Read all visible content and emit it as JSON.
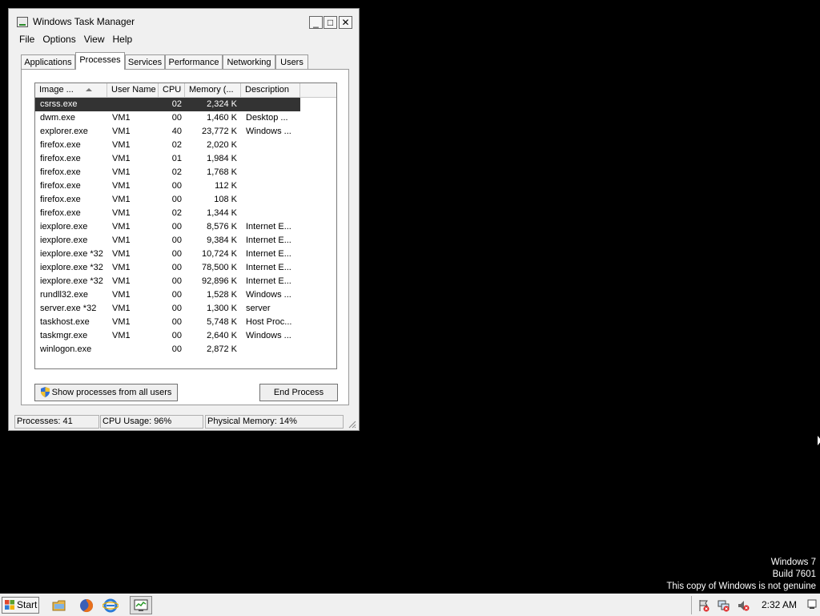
{
  "window": {
    "title": "Windows Task Manager",
    "controls": {
      "minimize": "_",
      "maximize": "□",
      "close": "✕"
    }
  },
  "menu": [
    "File",
    "Options",
    "View",
    "Help"
  ],
  "tabs": [
    "Applications",
    "Processes",
    "Services",
    "Performance",
    "Networking",
    "Users"
  ],
  "active_tab": "Processes",
  "columns": [
    "Image ...",
    "User Name",
    "CPU",
    "Memory (...",
    "Description"
  ],
  "processes": [
    {
      "name": "csrss.exe",
      "user": "",
      "cpu": "02",
      "mem": "2,324 K",
      "desc": ""
    },
    {
      "name": "dwm.exe",
      "user": "VM1",
      "cpu": "00",
      "mem": "1,460 K",
      "desc": "Desktop ..."
    },
    {
      "name": "explorer.exe",
      "user": "VM1",
      "cpu": "40",
      "mem": "23,772 K",
      "desc": "Windows ..."
    },
    {
      "name": "firefox.exe",
      "user": "VM1",
      "cpu": "02",
      "mem": "2,020 K",
      "desc": ""
    },
    {
      "name": "firefox.exe",
      "user": "VM1",
      "cpu": "01",
      "mem": "1,984 K",
      "desc": ""
    },
    {
      "name": "firefox.exe",
      "user": "VM1",
      "cpu": "02",
      "mem": "1,768 K",
      "desc": ""
    },
    {
      "name": "firefox.exe",
      "user": "VM1",
      "cpu": "00",
      "mem": "112 K",
      "desc": ""
    },
    {
      "name": "firefox.exe",
      "user": "VM1",
      "cpu": "00",
      "mem": "108 K",
      "desc": ""
    },
    {
      "name": "firefox.exe",
      "user": "VM1",
      "cpu": "02",
      "mem": "1,344 K",
      "desc": ""
    },
    {
      "name": "iexplore.exe",
      "user": "VM1",
      "cpu": "00",
      "mem": "8,576 K",
      "desc": "Internet E..."
    },
    {
      "name": "iexplore.exe",
      "user": "VM1",
      "cpu": "00",
      "mem": "9,384 K",
      "desc": "Internet E..."
    },
    {
      "name": "iexplore.exe *32",
      "user": "VM1",
      "cpu": "00",
      "mem": "10,724 K",
      "desc": "Internet E..."
    },
    {
      "name": "iexplore.exe *32",
      "user": "VM1",
      "cpu": "00",
      "mem": "78,500 K",
      "desc": "Internet E..."
    },
    {
      "name": "iexplore.exe *32",
      "user": "VM1",
      "cpu": "00",
      "mem": "92,896 K",
      "desc": "Internet E..."
    },
    {
      "name": "rundll32.exe",
      "user": "VM1",
      "cpu": "00",
      "mem": "1,528 K",
      "desc": "Windows ..."
    },
    {
      "name": "server.exe *32",
      "user": "VM1",
      "cpu": "00",
      "mem": "1,300 K",
      "desc": "server"
    },
    {
      "name": "taskhost.exe",
      "user": "VM1",
      "cpu": "00",
      "mem": "5,748 K",
      "desc": "Host Proc..."
    },
    {
      "name": "taskmgr.exe",
      "user": "VM1",
      "cpu": "00",
      "mem": "2,640 K",
      "desc": "Windows ..."
    },
    {
      "name": "winlogon.exe",
      "user": "",
      "cpu": "00",
      "mem": "2,872 K",
      "desc": ""
    }
  ],
  "selected_row": 0,
  "buttons": {
    "show_all": "Show processes from all users",
    "end_process": "End Process"
  },
  "status": {
    "processes": "Processes: 41",
    "cpu": "CPU Usage: 96%",
    "memory": "Physical Memory: 14%"
  },
  "watermark": [
    "Windows 7",
    "Build 7601",
    "This copy of Windows is not genuine"
  ],
  "taskbar": {
    "start_label": "Start",
    "clock": "2:32 AM",
    "pinned_icons": [
      "folder-icon",
      "firefox-icon",
      "internet-explorer-icon"
    ],
    "running_task_icon": "task-manager-icon",
    "tray_icons": [
      "action-center-icon",
      "network-icon",
      "volume-icon"
    ]
  },
  "colors": {
    "desktop": "#000000",
    "selection": "#333333",
    "window": "#f0f0f0"
  }
}
